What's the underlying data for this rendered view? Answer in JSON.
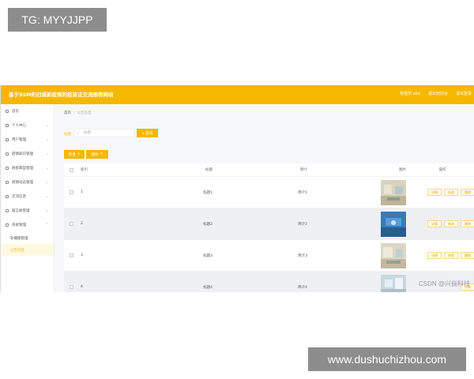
{
  "watermarks": {
    "top": "TG: MYYJJPP",
    "bottom": "www.dushuchizhou.com",
    "csdn": "CSDN @兴倘科技"
  },
  "header": {
    "title": "基于SSM的旧城新疫情的疫苗证交流推荐网站",
    "links": [
      "管理员 abo",
      "退出到前台",
      "退出登录"
    ]
  },
  "sidebar": {
    "items": [
      {
        "label": "首页",
        "icon": "home-icon"
      },
      {
        "label": "个人中心",
        "icon": "user-icon"
      },
      {
        "label": "用户管理",
        "icon": "users-icon"
      },
      {
        "label": "疫情知识管理",
        "icon": "book-icon"
      },
      {
        "label": "防疫典型管理",
        "icon": "shield-icon"
      },
      {
        "label": "疫情动态管理",
        "icon": "chart-icon"
      },
      {
        "label": "交流信息",
        "icon": "chat-icon"
      },
      {
        "label": "留言板管理",
        "icon": "message-icon"
      },
      {
        "label": "系统管理",
        "icon": "gear-icon"
      }
    ],
    "subitems": [
      {
        "label": "轮播图管理"
      },
      {
        "label": "公告信息"
      }
    ]
  },
  "main": {
    "breadcrumb": {
      "home": "首页",
      "sep": "/",
      "current": "公告信息"
    },
    "search": {
      "label": "标题",
      "placeholder": "标题",
      "button": "查询"
    },
    "actions": {
      "add": "新增",
      "delete": "删除"
    },
    "table": {
      "headers": {
        "index": "索引",
        "title": "标题",
        "intro": "简介",
        "image": "图片",
        "ops": "操作"
      },
      "rows": [
        {
          "index": "1",
          "title": "标题1",
          "intro": "简介1"
        },
        {
          "index": "2",
          "title": "标题2",
          "intro": "简介2"
        },
        {
          "index": "3",
          "title": "标题3",
          "intro": "简介3"
        },
        {
          "index": "4",
          "title": "标题4",
          "intro": "简介4"
        }
      ],
      "ops": {
        "detail": "详情",
        "edit": "修改",
        "delete": "删除"
      }
    }
  },
  "colors": {
    "accent": "#f5b800"
  }
}
